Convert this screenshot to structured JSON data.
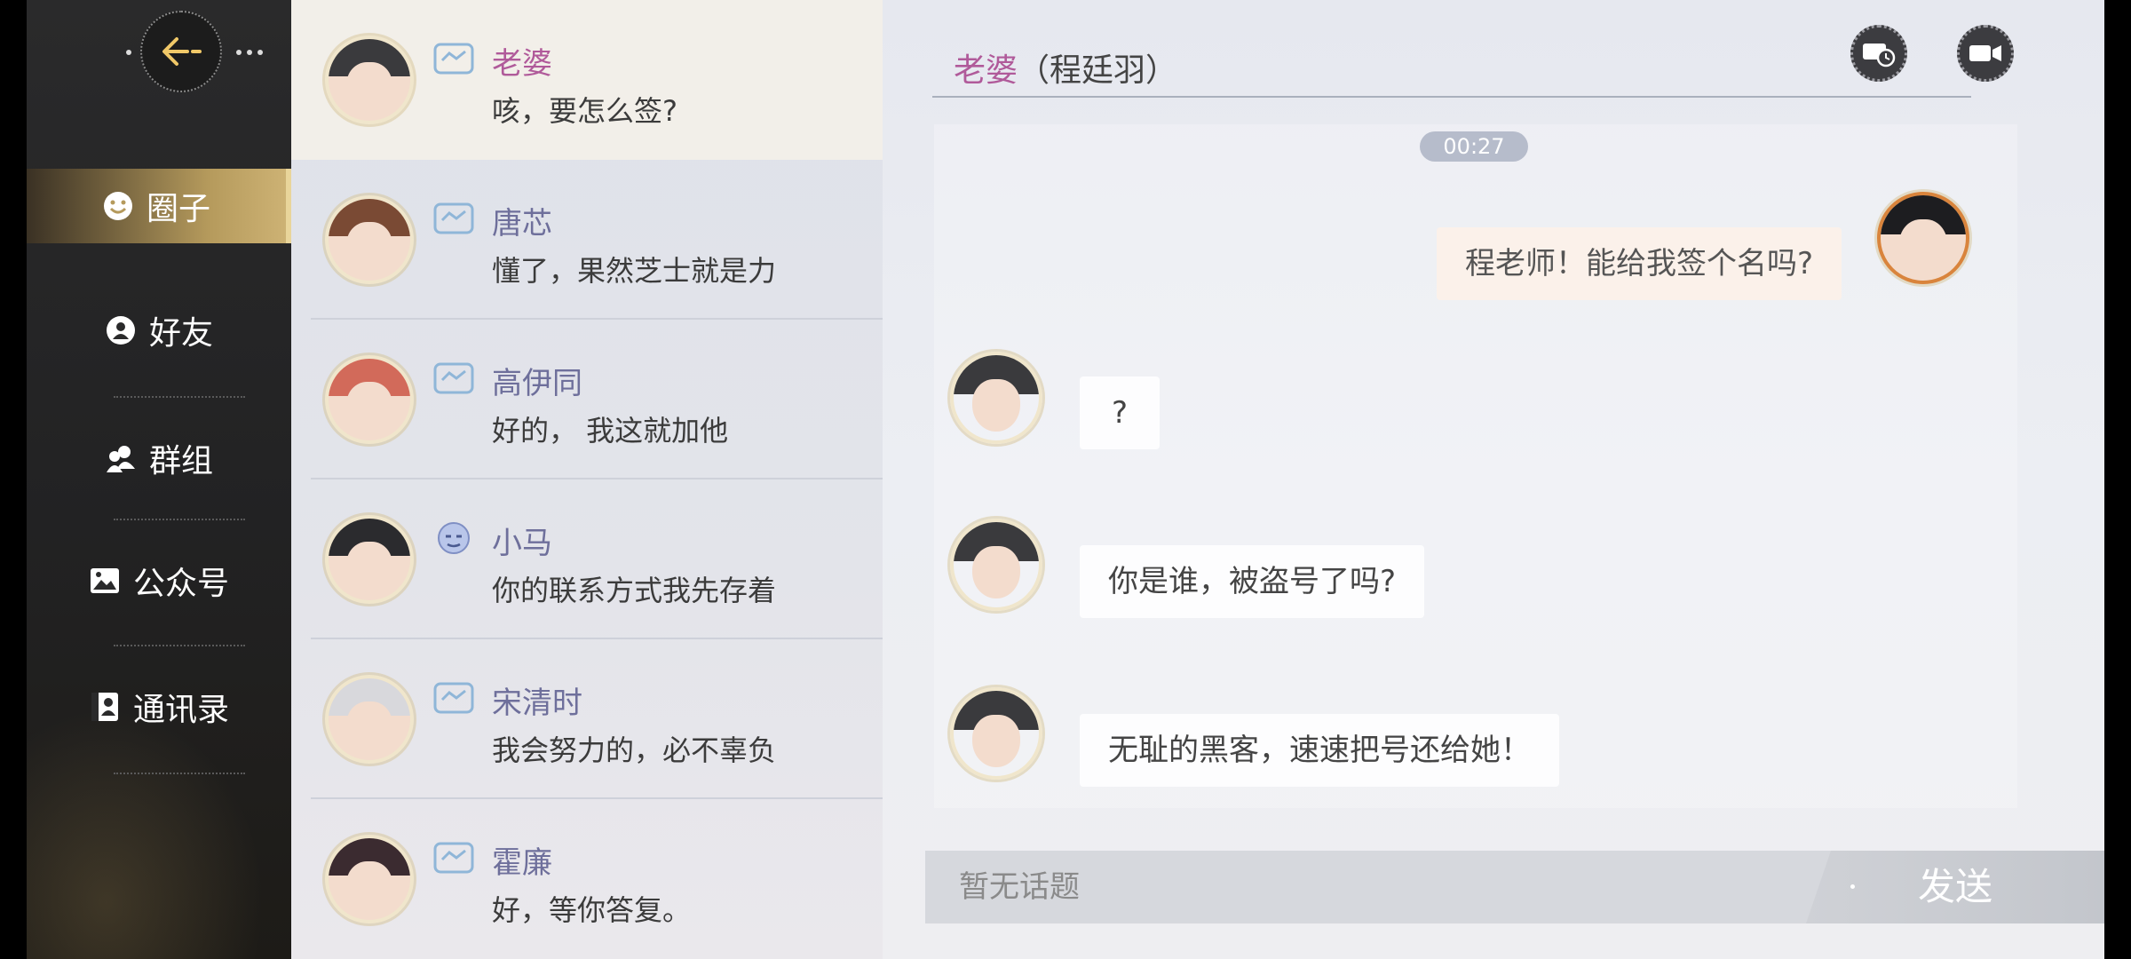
{
  "nav": {
    "back_icon": "back-arrow-icon",
    "items": [
      {
        "label": "圈子",
        "icon": "smiley-icon",
        "active": true
      },
      {
        "label": "好友",
        "icon": "friend-icon",
        "active": false
      },
      {
        "label": "群组",
        "icon": "group-icon",
        "active": false
      },
      {
        "label": "公众号",
        "icon": "image-icon",
        "active": false
      },
      {
        "label": "通讯录",
        "icon": "contacts-book-icon",
        "active": false
      }
    ]
  },
  "contacts": [
    {
      "name": "老婆",
      "message": "咳，要怎么签?",
      "badge": "handshake-icon",
      "selected": true
    },
    {
      "name": "唐芯",
      "message": "懂了，果然芝士就是力",
      "badge": "handshake-icon",
      "selected": false
    },
    {
      "name": "高伊同",
      "message": "好的， 我这就加他",
      "badge": "handshake-icon",
      "selected": false
    },
    {
      "name": "小马",
      "message": "你的联系方式我先存着",
      "badge": "face-icon",
      "selected": false
    },
    {
      "name": "宋清时",
      "message": "我会努力的，必不辜负",
      "badge": "handshake-icon",
      "selected": false
    },
    {
      "name": "霍廉",
      "message": "好，等你答复。",
      "badge": "handshake-icon",
      "selected": false
    }
  ],
  "chat": {
    "header_name": "老婆",
    "header_subtitle": "（程廷羽）",
    "timestamp": "00:27",
    "messages": [
      {
        "side": "right",
        "text": "程老师！能给我签个名吗?"
      },
      {
        "side": "left",
        "text": "?"
      },
      {
        "side": "left",
        "text": "你是谁，被盗号了吗?"
      },
      {
        "side": "left",
        "text": "无耻的黑客，速速把号还给她！"
      }
    ],
    "input_placeholder": "暂无话题",
    "send_label": "发送"
  },
  "colors": {
    "accent_pink": "#b05a9a",
    "nav_active_gold": "#cdb274",
    "contact_name": "#6e6f9b"
  }
}
